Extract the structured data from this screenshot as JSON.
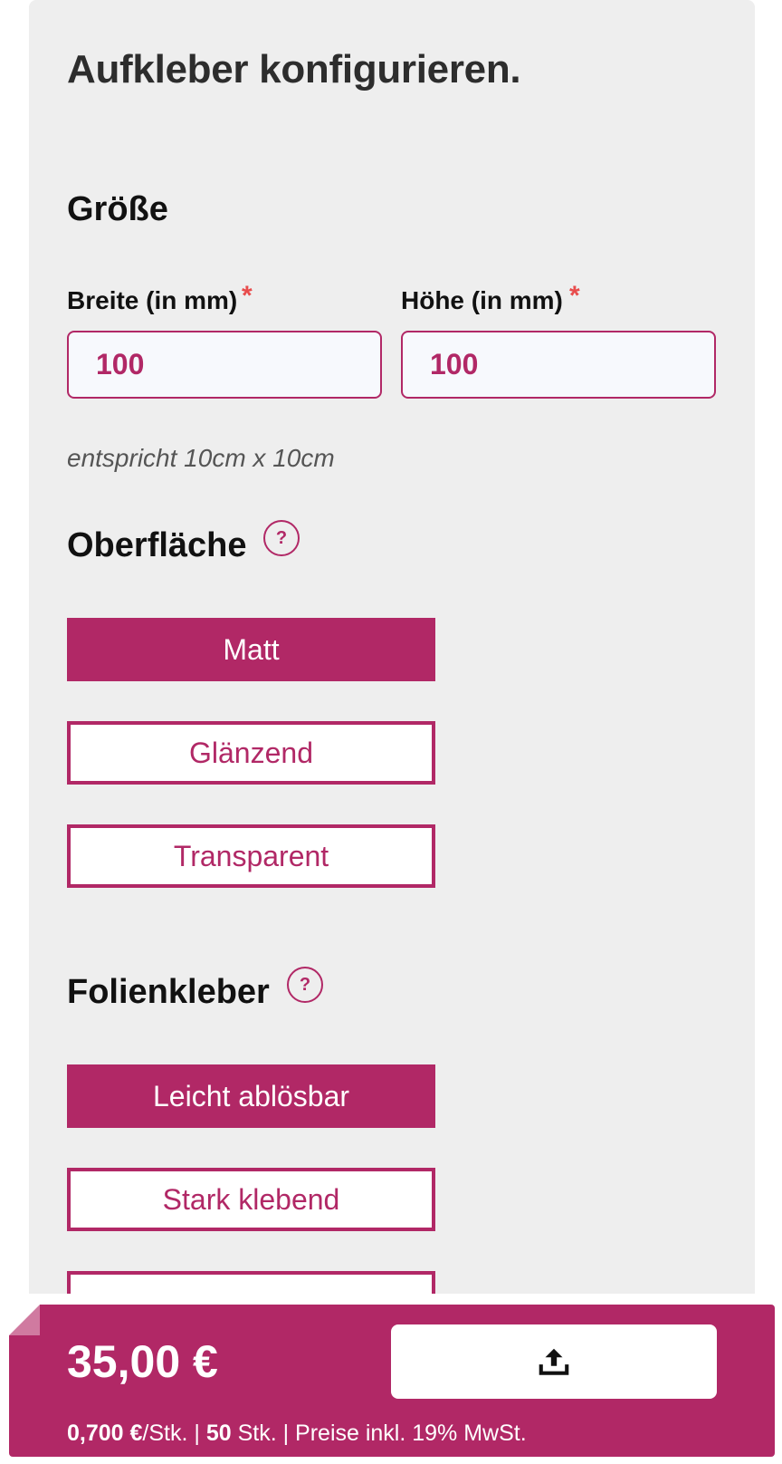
{
  "title": "Aufkleber konfigurieren.",
  "size_section": {
    "title": "Größe",
    "width_label": "Breite (in mm)",
    "height_label": "Höhe (in mm)",
    "required_marker": "*",
    "width_value": "100",
    "height_value": "100",
    "hint": "entspricht 10cm x 10cm"
  },
  "surface_section": {
    "title": "Oberfläche",
    "help": "?",
    "options": [
      "Matt",
      "Glänzend",
      "Transparent"
    ],
    "selected": "Matt"
  },
  "adhesive_section": {
    "title": "Folienkleber",
    "help": "?",
    "options": [
      "Leicht ablösbar",
      "Stark klebend"
    ],
    "selected": "Leicht ablösbar"
  },
  "footer": {
    "price": "35,00 €",
    "unit_price": "0,700 €",
    "unit_suffix": "/Stk. | ",
    "quantity": "50",
    "quantity_suffix": " Stk. | Preise inkl. 19% MwSt."
  },
  "icons": {
    "help": "question-circle-icon",
    "upload": "upload-icon"
  },
  "colors": {
    "accent": "#b12866",
    "panel_bg": "#eeeeee",
    "required": "#e84c4c"
  }
}
